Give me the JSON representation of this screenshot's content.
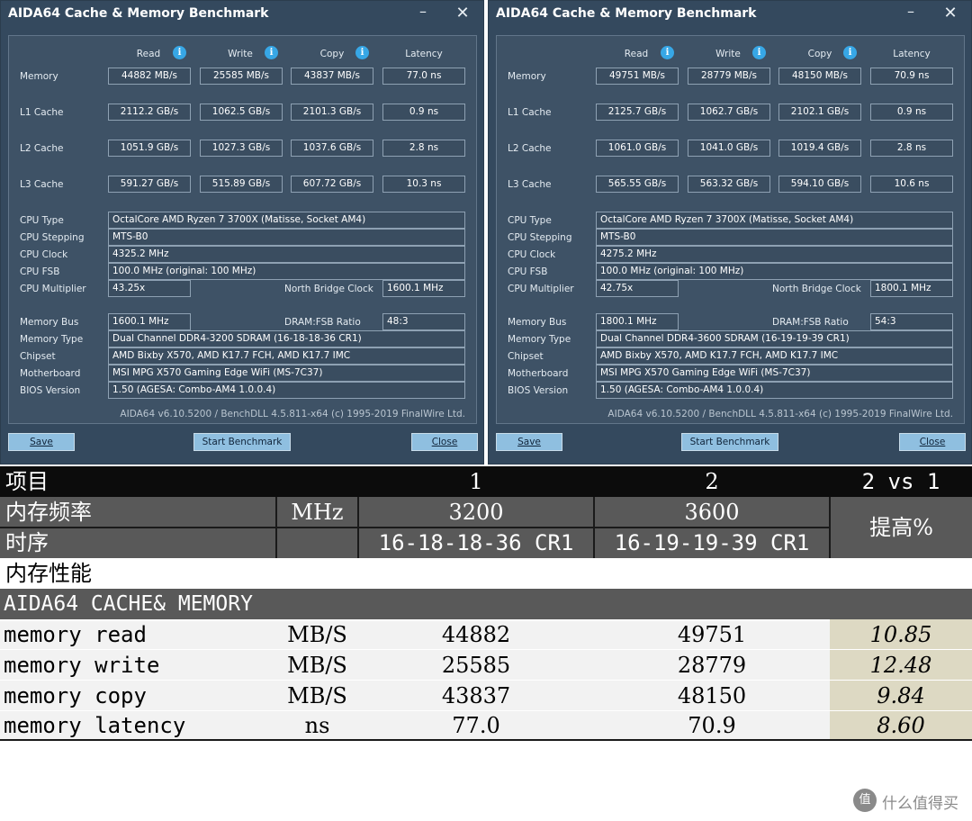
{
  "windows": [
    {
      "title": "AIDA64 Cache & Memory Benchmark",
      "headers": [
        "Read",
        "Write",
        "Copy",
        "Latency"
      ],
      "info_icon": "i",
      "rows": [
        {
          "label": "Memory",
          "values": [
            "44882 MB/s",
            "25585 MB/s",
            "43837 MB/s",
            "77.0 ns"
          ]
        },
        {
          "label": "L1 Cache",
          "values": [
            "2112.2 GB/s",
            "1062.5 GB/s",
            "2101.3 GB/s",
            "0.9 ns"
          ]
        },
        {
          "label": "L2 Cache",
          "values": [
            "1051.9 GB/s",
            "1027.3 GB/s",
            "1037.6 GB/s",
            "2.8 ns"
          ]
        },
        {
          "label": "L3 Cache",
          "values": [
            "591.27 GB/s",
            "515.89 GB/s",
            "607.72 GB/s",
            "10.3 ns"
          ]
        }
      ],
      "cpu_type_label": "CPU Type",
      "cpu_type": "OctalCore AMD Ryzen 7 3700X  (Matisse, Socket AM4)",
      "cpu_stepping_label": "CPU Stepping",
      "cpu_stepping": "MTS-B0",
      "cpu_clock_label": "CPU Clock",
      "cpu_clock": "4325.2 MHz",
      "cpu_fsb_label": "CPU FSB",
      "cpu_fsb": "100.0 MHz  (original: 100 MHz)",
      "cpu_multiplier_label": "CPU Multiplier",
      "cpu_multiplier": "43.25x",
      "nb_clock_label": "North Bridge Clock",
      "nb_clock": "1600.1 MHz",
      "memory_bus_label": "Memory Bus",
      "memory_bus": "1600.1 MHz",
      "dram_fsb_label": "DRAM:FSB Ratio",
      "dram_fsb": "48:3",
      "memory_type_label": "Memory Type",
      "memory_type": "Dual Channel DDR4-3200 SDRAM  (16-18-18-36 CR1)",
      "chipset_label": "Chipset",
      "chipset": "AMD Bixby X570, AMD K17.7 FCH, AMD K17.7 IMC",
      "motherboard_label": "Motherboard",
      "motherboard": "MSI MPG X570 Gaming Edge WiFi (MS-7C37)",
      "bios_label": "BIOS Version",
      "bios": "1.50  (AGESA: Combo-AM4 1.0.0.4)",
      "footer": "AIDA64 v6.10.5200 / BenchDLL 4.5.811-x64  (c) 1995-2019 FinalWire Ltd.",
      "save_label": "Save",
      "start_label": "Start Benchmark",
      "close_label": "Close",
      "minimize_glyph": "–",
      "close_glyph": "✕"
    },
    {
      "title": "AIDA64 Cache & Memory Benchmark",
      "headers": [
        "Read",
        "Write",
        "Copy",
        "Latency"
      ],
      "info_icon": "i",
      "rows": [
        {
          "label": "Memory",
          "values": [
            "49751 MB/s",
            "28779 MB/s",
            "48150 MB/s",
            "70.9 ns"
          ]
        },
        {
          "label": "L1 Cache",
          "values": [
            "2125.7 GB/s",
            "1062.7 GB/s",
            "2102.1 GB/s",
            "0.9 ns"
          ]
        },
        {
          "label": "L2 Cache",
          "values": [
            "1061.0 GB/s",
            "1041.0 GB/s",
            "1019.4 GB/s",
            "2.8 ns"
          ]
        },
        {
          "label": "L3 Cache",
          "values": [
            "565.55 GB/s",
            "563.32 GB/s",
            "594.10 GB/s",
            "10.6 ns"
          ]
        }
      ],
      "cpu_type_label": "CPU Type",
      "cpu_type": "OctalCore AMD Ryzen 7 3700X  (Matisse, Socket AM4)",
      "cpu_stepping_label": "CPU Stepping",
      "cpu_stepping": "MTS-B0",
      "cpu_clock_label": "CPU Clock",
      "cpu_clock": "4275.2 MHz",
      "cpu_fsb_label": "CPU FSB",
      "cpu_fsb": "100.0 MHz  (original: 100 MHz)",
      "cpu_multiplier_label": "CPU Multiplier",
      "cpu_multiplier": "42.75x",
      "nb_clock_label": "North Bridge Clock",
      "nb_clock": "1800.1 MHz",
      "memory_bus_label": "Memory Bus",
      "memory_bus": "1800.1 MHz",
      "dram_fsb_label": "DRAM:FSB Ratio",
      "dram_fsb": "54:3",
      "memory_type_label": "Memory Type",
      "memory_type": "Dual Channel DDR4-3600 SDRAM  (16-19-19-39 CR1)",
      "chipset_label": "Chipset",
      "chipset": "AMD Bixby X570, AMD K17.7 FCH, AMD K17.7 IMC",
      "motherboard_label": "Motherboard",
      "motherboard": "MSI MPG X570 Gaming Edge WiFi (MS-7C37)",
      "bios_label": "BIOS Version",
      "bios": "1.50  (AGESA: Combo-AM4 1.0.0.4)",
      "footer": "AIDA64 v6.10.5200 / BenchDLL 4.5.811-x64  (c) 1995-2019 FinalWire Ltd.",
      "save_label": "Save",
      "start_label": "Start Benchmark",
      "close_label": "Close",
      "minimize_glyph": "–",
      "close_glyph": "✕"
    }
  ],
  "table": {
    "head": {
      "item": "项目",
      "col1": "1",
      "col2": "2",
      "vs": "2 vs 1"
    },
    "freq": {
      "label": "内存频率",
      "unit": "MHz",
      "v1": "3200",
      "v2": "3600"
    },
    "timing": {
      "label": "时序",
      "v1": "16-18-18-36 CR1",
      "v2": "16-19-19-39 CR1"
    },
    "improve_label": "提高%",
    "section": "内存性能",
    "subsection": "AIDA64 CACHE& MEMORY",
    "rows": [
      {
        "label": "memory read",
        "unit": "MB/S",
        "v1": "44882",
        "v2": "49751",
        "pct": "10.85"
      },
      {
        "label": "memory write",
        "unit": "MB/S",
        "v1": "25585",
        "v2": "28779",
        "pct": "12.48"
      },
      {
        "label": "memory copy",
        "unit": "MB/S",
        "v1": "43837",
        "v2": "48150",
        "pct": "9.84"
      },
      {
        "label": "memory latency",
        "unit": "ns",
        "v1": "77.0",
        "v2": "70.9",
        "pct": "8.60"
      }
    ]
  },
  "watermark": {
    "icon": "值",
    "text": "什么值得买"
  },
  "colors": {
    "window_bg": "#34495e",
    "panel_bg": "#3e5266",
    "button_bg": "#8fbfe0",
    "info_icon": "#37a7e6",
    "table_dark": "#0c0c0c",
    "table_gray": "#595959",
    "highlight": "#ddd9c3"
  }
}
